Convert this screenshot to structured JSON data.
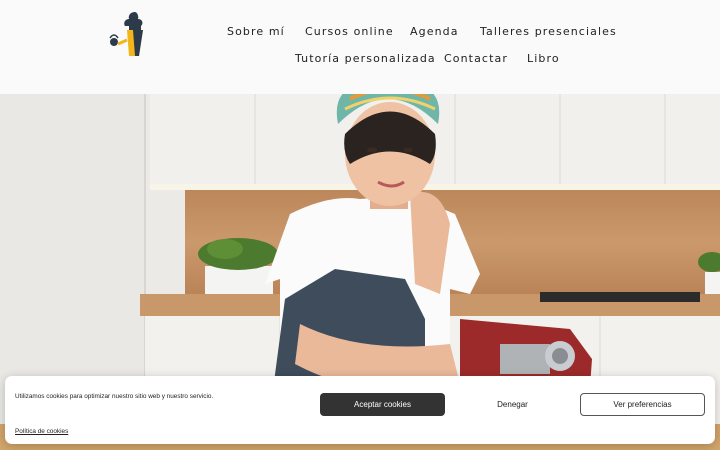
{
  "header": {
    "logo_alt": "Logo",
    "nav": [
      {
        "label": "Sobre mí"
      },
      {
        "label": "Cursos online"
      },
      {
        "label": "Agenda"
      },
      {
        "label": "Talleres presenciales"
      },
      {
        "label": "Tutoría personalizada"
      },
      {
        "label": "Contactar"
      },
      {
        "label": "Libro"
      }
    ]
  },
  "colors": {
    "header_bg": "#fafafa",
    "accent_yellow": "#f2b61b",
    "accept_button_bg": "#333333",
    "logo_dark": "#2d3a4a"
  },
  "cookie_banner": {
    "message": "Utilizamos cookies para optimizar nuestro sitio web y nuestro servicio.",
    "policy_link": "Política de cookies",
    "accept_label": "Aceptar cookies",
    "deny_label": "Denegar",
    "preferences_label": "Ver preferencias"
  }
}
